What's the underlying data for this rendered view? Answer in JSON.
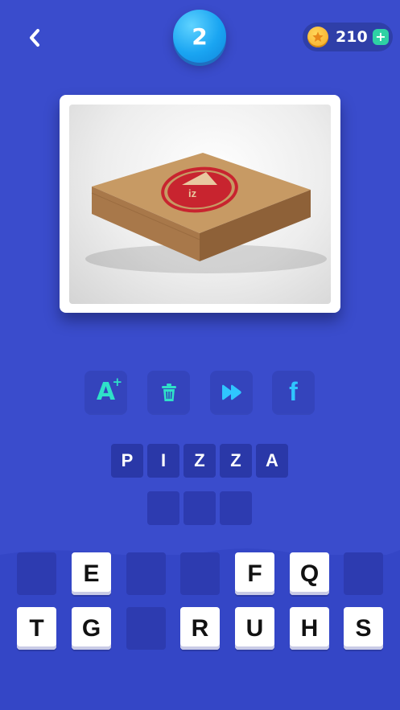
{
  "header": {
    "back_icon": "chevron-left-icon",
    "level": "2",
    "coins": "210",
    "coin_icon": "star-coin-icon",
    "add_coins_icon": "plus-icon",
    "plus_symbol": "+"
  },
  "puzzle_image": {
    "subject": "pizza box with red logo",
    "logo_text": "iz"
  },
  "hints": [
    {
      "icon": "reveal-letter-icon",
      "label": "A",
      "sup": "+"
    },
    {
      "icon": "trash-icon"
    },
    {
      "icon": "skip-icon"
    },
    {
      "icon": "facebook-icon",
      "label": "f"
    }
  ],
  "answer": {
    "row1": [
      "P",
      "I",
      "Z",
      "Z",
      "A"
    ],
    "row2": [
      "",
      "",
      ""
    ]
  },
  "keyboard": {
    "row1": [
      "",
      "E",
      "",
      "",
      "F",
      "Q",
      ""
    ],
    "row2": [
      "T",
      "G",
      "",
      "R",
      "U",
      "H",
      "S"
    ]
  },
  "colors": {
    "background": "#3a4ccc",
    "accent_teal": "#2fe0c8",
    "level_badge": "#1aa5f2",
    "coin": "#f5a623",
    "logo_red": "#c8242f"
  }
}
